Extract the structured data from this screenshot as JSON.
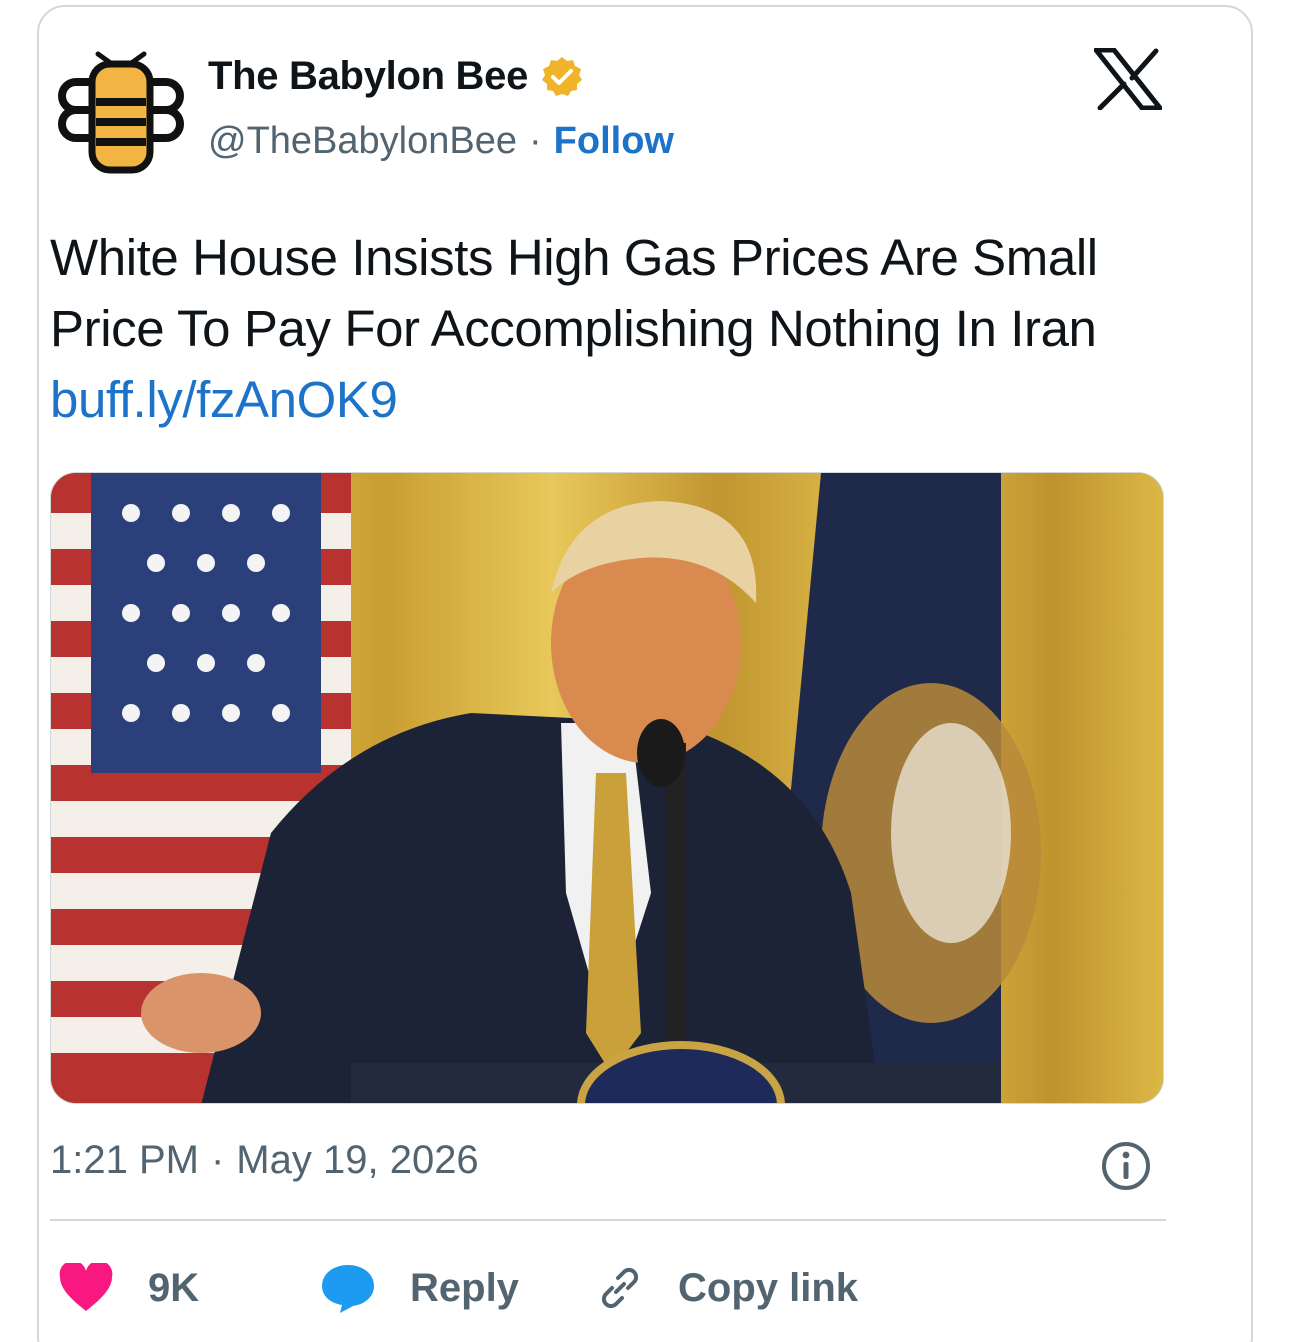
{
  "author": {
    "display_name": "The Babylon Bee",
    "handle": "@TheBabylonBee",
    "separator": "·",
    "follow_label": "Follow",
    "verified_color": "#f0b429",
    "avatar_icon": "babylon-bee-logo"
  },
  "platform_icon": "x-logo",
  "tweet": {
    "text": "White House Insists High Gas Prices Are Small Price To Pay For Accomplishing Nothing In Iran",
    "link": "buff.ly/fzAnOK9",
    "link_color": "#1d72c9"
  },
  "media": {
    "image_icon": "photo-of-speaker-at-podium"
  },
  "meta": {
    "time": "1:21 PM",
    "separator": "·",
    "date": "May 19, 2026"
  },
  "actions": {
    "likes_count": "9K",
    "reply_label": "Reply",
    "copy_link_label": "Copy link",
    "heart_color": "#f91880",
    "reply_icon_color": "#1d9bf0"
  }
}
